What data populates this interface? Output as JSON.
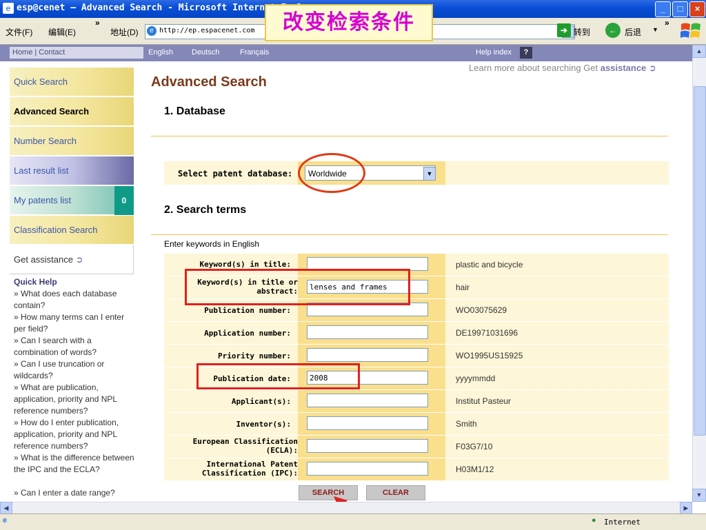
{
  "window": {
    "title": "esp@cenet — Advanced Search - Microsoft Internet Explorer"
  },
  "overlay_text": "改变检索条件",
  "menubar": {
    "file": "文件(F)",
    "edit": "编辑(E)",
    "more": "»",
    "address_label": "地址(D)",
    "url": "http://ep.espacenet.com",
    "go": "转到",
    "back": "后退",
    "more_right": "»"
  },
  "sitenav": {
    "home_contact": "Home | Contact",
    "english": "English",
    "deutsch": "Deutsch",
    "francais": "Français",
    "help_index": "Help index",
    "help_q": "?"
  },
  "sidebar": {
    "quick_search": "Quick Search",
    "advanced_search": "Advanced Search",
    "number_search": "Number Search",
    "last_result": "Last result list",
    "my_patents": "My patents list",
    "my_patents_count": "0",
    "classification": "Classification Search",
    "get_assistance": "Get assistance"
  },
  "quick_help": {
    "title": "Quick Help",
    "items": [
      "» What does each database contain?",
      "» How many terms can I enter per field?",
      "» Can I search with a combination of words?",
      "» Can I use truncation or wildcards?",
      "» What are publication, application, priority and NPL reference numbers?",
      "» How do I enter publication, application, priority and NPL reference numbers?",
      "» What is the difference between the IPC and the ECLA?",
      "» Can I enter a date range?"
    ]
  },
  "main": {
    "page_title": "Advanced Search",
    "learn_more": "Learn more about searching Get",
    "assistance": "assistance",
    "section1": "1. Database",
    "select_db_label": "Select patent database:",
    "db_value": "Worldwide",
    "section2": "2. Search terms",
    "enter_keywords": "Enter keywords in English",
    "fields": [
      {
        "label": "Keyword(s) in title:",
        "value": "",
        "example": "plastic and bicycle"
      },
      {
        "label": "Keyword(s) in title or abstract:",
        "value": "lenses and frames",
        "example": "hair"
      },
      {
        "label": "Publication number:",
        "value": "",
        "example": "WO03075629"
      },
      {
        "label": "Application number:",
        "value": "",
        "example": "DE19971031696"
      },
      {
        "label": "Priority number:",
        "value": "",
        "example": "WO1995US15925"
      },
      {
        "label": "Publication date:",
        "value": "2008",
        "example": "yyyymmdd"
      },
      {
        "label": "Applicant(s):",
        "value": "",
        "example": "Institut Pasteur"
      },
      {
        "label": "Inventor(s):",
        "value": "",
        "example": "Smith"
      },
      {
        "label": "European Classification (ECLA):",
        "value": "",
        "example": "F03G7/10"
      },
      {
        "label": "International Patent Classification (IPC):",
        "value": "",
        "example": "H03M1/12"
      }
    ],
    "search_button": "SEARCH",
    "clear_button": "CLEAR"
  },
  "statusbar": {
    "zone": "Internet"
  },
  "colors": {
    "annotation_red": "#e02020",
    "panel_yellow": "#fdf6d8",
    "panel_gold": "#fadf8c",
    "overlay_text": "#d400d4"
  }
}
